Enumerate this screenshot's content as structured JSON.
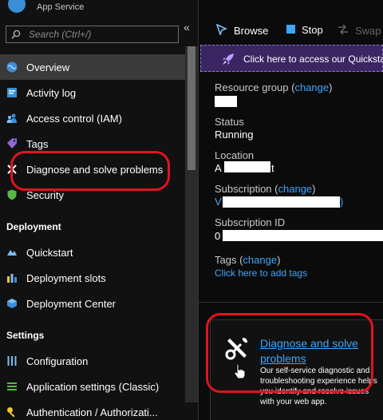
{
  "header": {
    "title_clip": "",
    "subtitle": "App Service"
  },
  "search": {
    "placeholder": "Search (Ctrl+/)",
    "collapse_glyph": "«"
  },
  "nav": {
    "overview": "Overview",
    "activity_log": "Activity log",
    "access_control": "Access control (IAM)",
    "tags": "Tags",
    "diagnose": "Diagnose and solve problems",
    "security": "Security",
    "section_deployment": "Deployment",
    "quickstart": "Quickstart",
    "deployment_slots": "Deployment slots",
    "deployment_center": "Deployment Center",
    "section_settings": "Settings",
    "configuration": "Configuration",
    "app_settings_classic": "Application settings (Classic)",
    "authentication": "Authentication / Authorizati..."
  },
  "toolbar": {
    "browse": "Browse",
    "stop": "Stop",
    "swap": "Swap"
  },
  "banner": {
    "text": "Click here to access our Quickstar"
  },
  "essentials": {
    "resource_group_label": "Resource group",
    "change": "change",
    "status_label": "Status",
    "status_value": "Running",
    "location_label": "Location",
    "location_visible_start": "A",
    "location_visible_end": "t",
    "subscription_label": "Subscription",
    "subscription_visible_start": "V",
    "subscription_visible_end": ")",
    "subscription_id_label": "Subscription ID",
    "subscription_id_visible_start": "0",
    "tags_label": "Tags",
    "add_tags": "Click here to add tags"
  },
  "tool_card": {
    "title": "Diagnose and solve problems",
    "description": "Our self-service diagnostic and troubleshooting experience helps you identify and resolve issues with your web app."
  },
  "colors": {
    "accent_link": "#3ea6ff",
    "annotation_red": "#e0141e",
    "banner_bg": "#3a2663"
  }
}
